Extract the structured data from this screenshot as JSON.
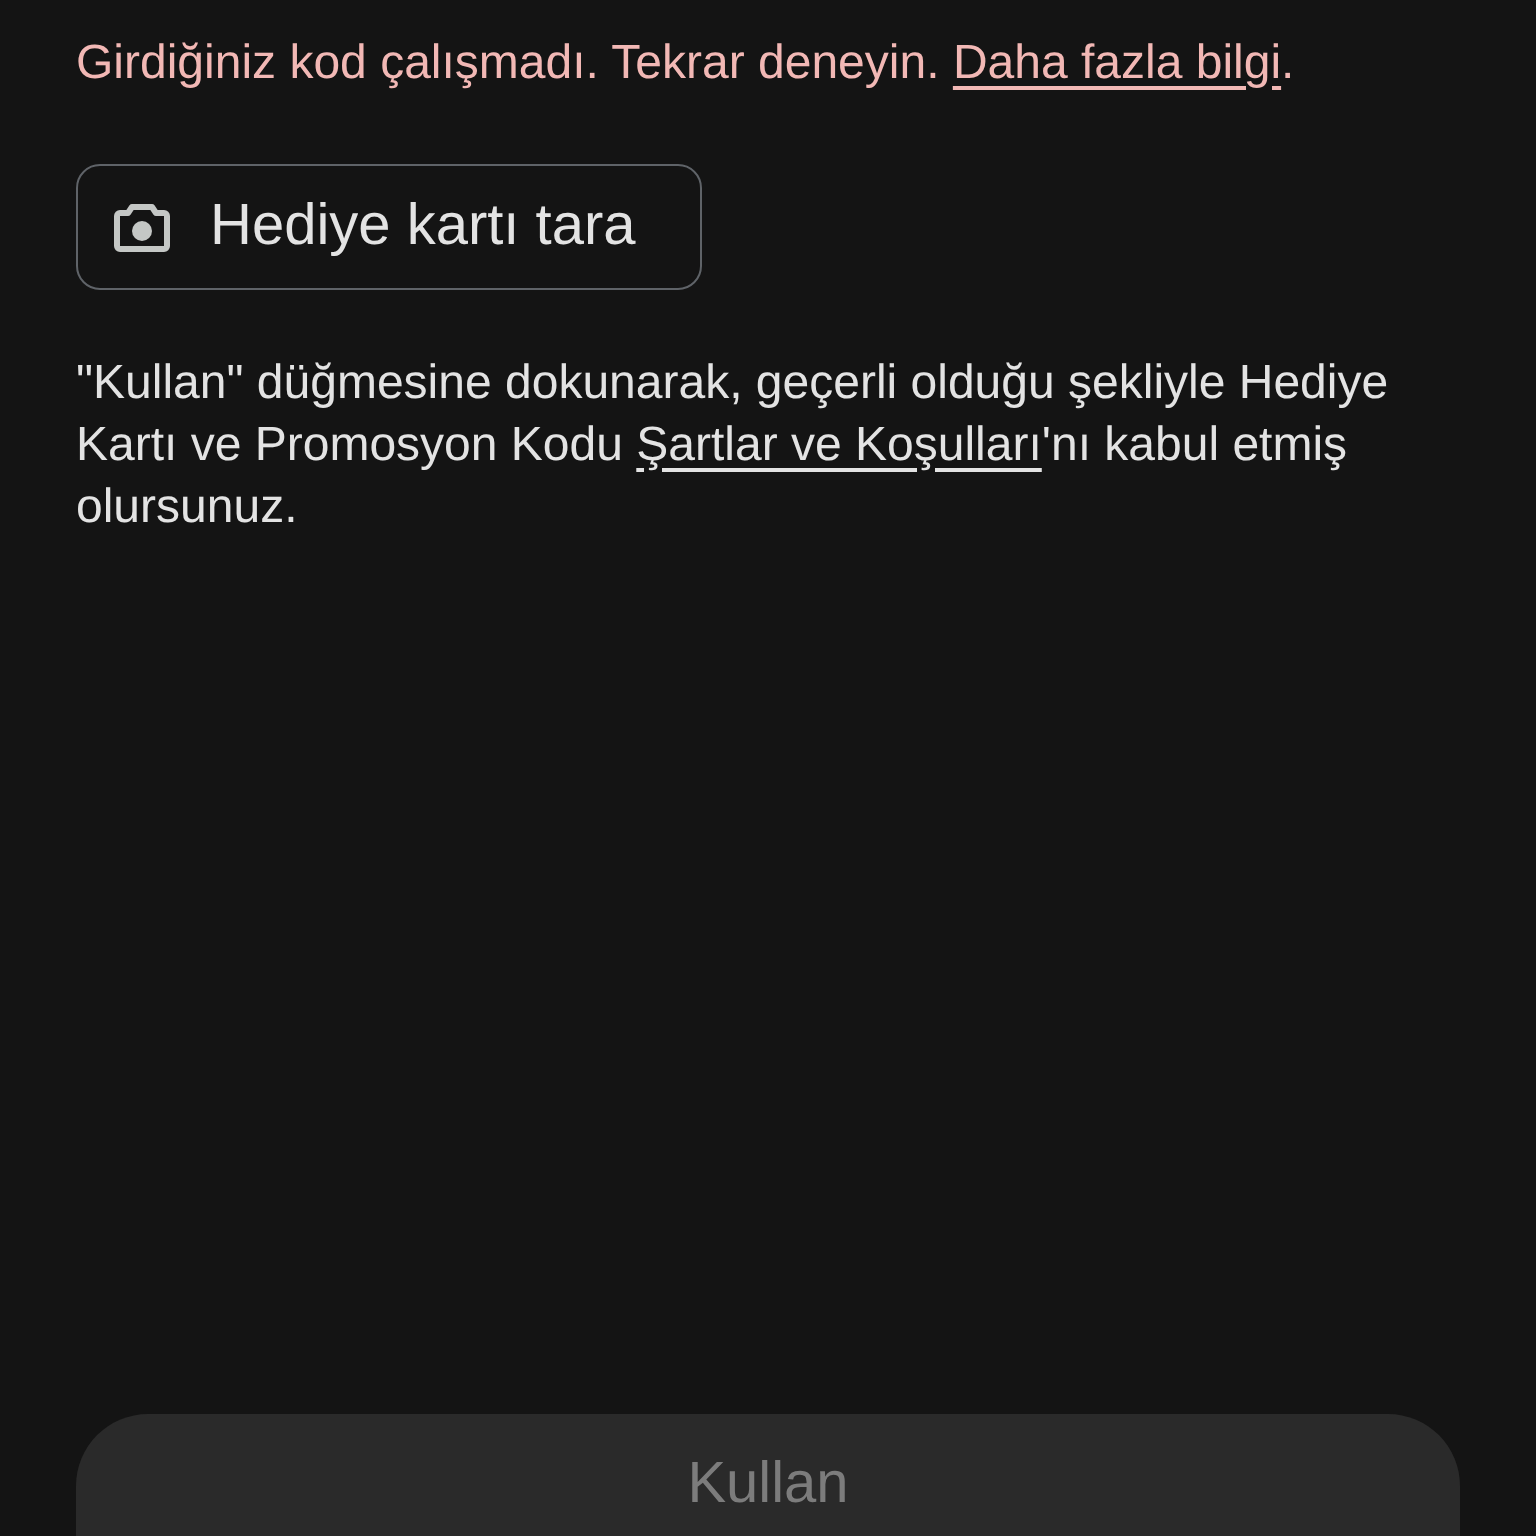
{
  "error": {
    "text": "Girdiğiniz kod çalışmadı. Tekrar deneyin.",
    "link": "Daha fazla bilgi",
    "suffix": "."
  },
  "scan_button": {
    "label": "Hediye kartı tara"
  },
  "terms": {
    "before": "\"Kullan\" düğmesine dokunarak, geçerli olduğu şekliyle Hediye Kartı ve Promosyon Kodu",
    "link": "Şartlar ve Koşulları",
    "after": "'nı kabul etmiş olursunuz."
  },
  "redeem_button": {
    "label": "Kullan",
    "disabled": true
  }
}
